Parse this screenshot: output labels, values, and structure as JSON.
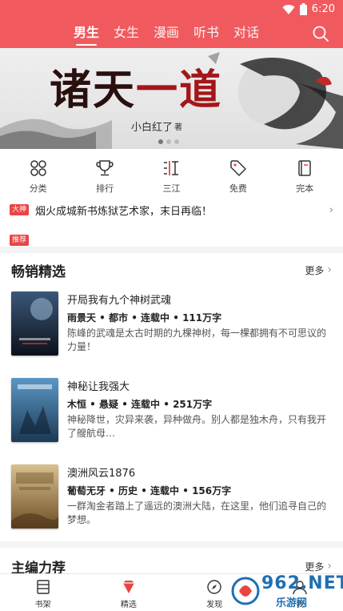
{
  "status": {
    "time": "6:20"
  },
  "nav": {
    "tabs": [
      "男生",
      "女生",
      "漫画",
      "听书",
      "对话"
    ],
    "active_index": 0
  },
  "banner": {
    "title_part1": "诸天",
    "title_part2": "一道",
    "author": "小白红了",
    "author_suffix": "著"
  },
  "categories": [
    {
      "label": "分类",
      "icon": "grid-circles-icon"
    },
    {
      "label": "排行",
      "icon": "trophy-icon"
    },
    {
      "label": "三江",
      "icon": "sanjiang-icon"
    },
    {
      "label": "免费",
      "icon": "tag-icon"
    },
    {
      "label": "完本",
      "icon": "book-icon"
    }
  ],
  "news": [
    {
      "tag": "大神",
      "text": "烟火成城新书炼狱艺术家，末日再临！"
    },
    {
      "tag": "推荐",
      "text": ""
    }
  ],
  "bestsellers": {
    "title": "畅销精选",
    "more": "更多",
    "books": [
      {
        "title": "开局我有九个神树武魂",
        "meta": "雨景天 • 都市 • 连载中 • 111万字",
        "desc": "陈峰的武魂是太古时期的九棵神树，每一棵都拥有不可思议的力量！",
        "cover_colors": [
          "#2b3a4e",
          "#0f1622"
        ]
      },
      {
        "title": "神秘让我强大",
        "meta": "木恒 • 悬疑 • 连载中 • 251万字",
        "desc": "神秘降世，灾异来袭，异种做舟。别人都是独木舟，只有我开了艘航母…",
        "cover_colors": [
          "#4a7fa8",
          "#1e3c57"
        ]
      },
      {
        "title": "澳洲风云1876",
        "meta": "葡萄无牙 • 历史 • 连载中 • 156万字",
        "desc": "一群淘金者踏上了遥远的澳洲大陆，在这里，他们追寻自己的梦想。",
        "cover_colors": [
          "#c7ad7c",
          "#7a5a2e"
        ]
      }
    ]
  },
  "editors": {
    "title": "主编力荐",
    "more": "更多"
  },
  "bottom_nav": [
    {
      "label": "书架",
      "icon": "bookshelf-icon"
    },
    {
      "label": "精选",
      "icon": "diamond-icon"
    },
    {
      "label": "发现",
      "icon": "compass-icon"
    },
    {
      "label": "我",
      "icon": "user-icon"
    }
  ],
  "watermark": {
    "text": "962.NET",
    "sub": "乐游网"
  },
  "colors": {
    "brand": "#f05a5f",
    "tag_red": "#e84545"
  }
}
